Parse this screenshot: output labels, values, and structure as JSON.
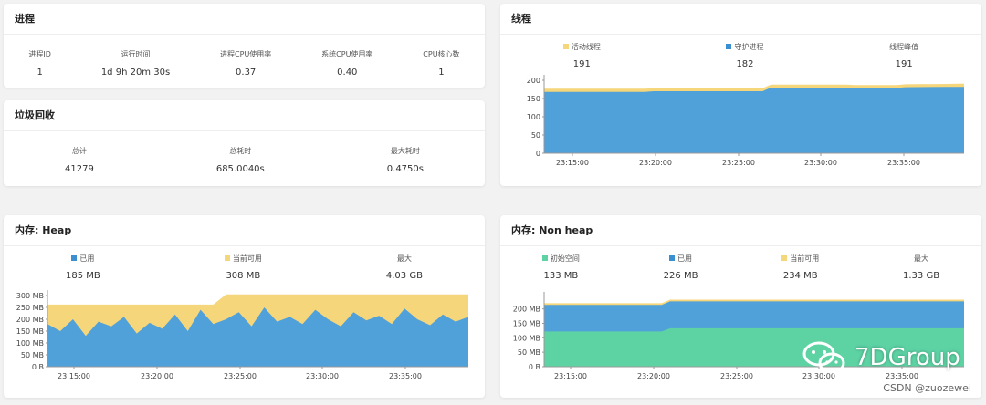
{
  "process": {
    "title": "进程",
    "stats": [
      {
        "label": "进程ID",
        "value": "1"
      },
      {
        "label": "运行时间",
        "value": "1d 9h 20m 30s"
      },
      {
        "label": "进程CPU使用率",
        "value": "0.37"
      },
      {
        "label": "系统CPU使用率",
        "value": "0.40"
      },
      {
        "label": "CPU核心数",
        "value": "1"
      }
    ]
  },
  "gc": {
    "title": "垃圾回收",
    "stats": [
      {
        "label": "总计",
        "value": "41279"
      },
      {
        "label": "总耗时",
        "value": "685.0040s"
      },
      {
        "label": "最大耗时",
        "value": "0.4750s"
      }
    ]
  },
  "threads": {
    "title": "线程",
    "legend": [
      {
        "label": "活动线程",
        "value": "191",
        "color": "#f5d67a"
      },
      {
        "label": "守护进程",
        "value": "182",
        "color": "#3a8fd0"
      },
      {
        "label": "线程峰值",
        "value": "191"
      }
    ]
  },
  "heap": {
    "title": "内存: Heap",
    "legend": [
      {
        "label": "已用",
        "value": "185 MB",
        "color": "#3a8fd0"
      },
      {
        "label": "当前可用",
        "value": "308 MB",
        "color": "#f5d67a"
      },
      {
        "label": "最大",
        "value": "4.03 GB"
      }
    ]
  },
  "nonheap": {
    "title": "内存: Non heap",
    "legend": [
      {
        "label": "初始空间",
        "value": "133 MB",
        "color": "#5dd3a4"
      },
      {
        "label": "已用",
        "value": "226 MB",
        "color": "#3a8fd0"
      },
      {
        "label": "当前可用",
        "value": "234 MB",
        "color": "#f5d67a"
      },
      {
        "label": "最大",
        "value": "1.33 GB"
      }
    ]
  },
  "chart_data": [
    {
      "type": "area",
      "x_ticks": [
        "23:15:00",
        "23:20:00",
        "23:25:00",
        "23:30:00",
        "23:35:00"
      ],
      "y_ticks": [
        "0",
        "50",
        "100",
        "150",
        "200"
      ],
      "ylim": [
        0,
        200
      ],
      "x": [
        0,
        12,
        13,
        26,
        27,
        36,
        37,
        42,
        43,
        48,
        50
      ],
      "series": [
        {
          "name": "守护进程",
          "color": "#50a0da",
          "values": [
            168,
            168,
            170,
            170,
            180,
            180,
            179,
            179,
            181,
            182,
            182
          ]
        },
        {
          "name": "活动线程",
          "color": "#f5d67a",
          "values": [
            177,
            177,
            178,
            178,
            188,
            188,
            187,
            187,
            189,
            190,
            191
          ]
        }
      ]
    },
    {
      "type": "area",
      "x_ticks": [
        "23:15:00",
        "23:20:00",
        "23:25:00",
        "23:30:00",
        "23:35:00"
      ],
      "y_ticks": [
        "0 B",
        "50 MB",
        "100 MB",
        "150 MB",
        "200 MB",
        "250 MB",
        "300 MB"
      ],
      "ylim": [
        0,
        300
      ],
      "x": [
        0,
        3,
        6,
        9,
        12,
        15,
        18,
        21,
        24,
        27,
        30,
        33,
        36,
        39,
        42,
        45,
        48,
        51,
        54,
        57,
        60,
        63,
        66,
        69,
        72,
        75,
        78,
        81,
        84,
        87,
        90,
        93,
        96,
        99
      ],
      "series": [
        {
          "name": "已用",
          "color": "#50a0da",
          "values": [
            180,
            150,
            200,
            130,
            190,
            170,
            210,
            140,
            185,
            160,
            220,
            150,
            240,
            180,
            200,
            230,
            170,
            250,
            190,
            210,
            180,
            240,
            200,
            170,
            230,
            195,
            215,
            180,
            245,
            200,
            175,
            220,
            190,
            210
          ]
        },
        {
          "name": "当前可用",
          "color": "#f5d67a",
          "values": [
            262,
            262,
            262,
            262,
            262,
            262,
            262,
            262,
            262,
            262,
            262,
            262,
            262,
            262,
            305,
            305,
            305,
            305,
            305,
            305,
            305,
            305,
            305,
            305,
            305,
            305,
            305,
            305,
            305,
            305,
            305,
            305,
            305,
            305
          ]
        }
      ]
    },
    {
      "type": "area",
      "x_ticks": [
        "23:15:00",
        "23:20:00",
        "23:25:00",
        "23:30:00",
        "23:35:00"
      ],
      "y_ticks": [
        "0 B",
        "50 MB",
        "100 MB",
        "150 MB",
        "200 MB"
      ],
      "ylim": [
        0,
        240
      ],
      "x": [
        0,
        14,
        15,
        50
      ],
      "series": [
        {
          "name": "初始空间",
          "color": "#5dd3a4",
          "values": [
            122,
            122,
            133,
            133
          ]
        },
        {
          "name": "已用",
          "color": "#50a0da",
          "values": [
            214,
            214,
            226,
            226
          ]
        },
        {
          "name": "当前可用",
          "color": "#f5d67a",
          "values": [
            220,
            220,
            232,
            232
          ]
        }
      ]
    }
  ],
  "watermark": {
    "brand": "7DGroup",
    "credit": "CSDN @zuozewei"
  }
}
